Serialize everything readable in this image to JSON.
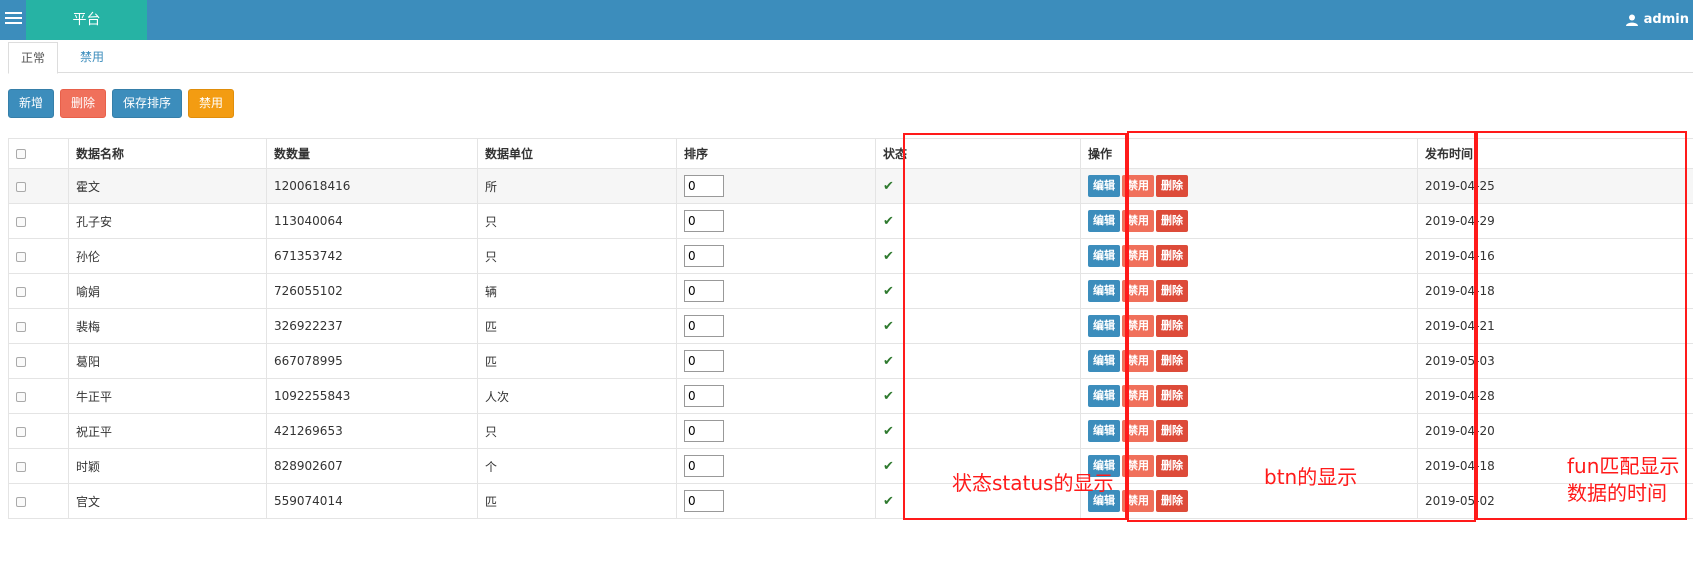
{
  "header": {
    "brand": "平台",
    "user": "admin",
    "menu_icon": "hamburger-icon",
    "user_icon": "user-icon",
    "color": "#3c8dbc",
    "brand_color": "#26b3a4"
  },
  "tabs": [
    {
      "label": "正常",
      "active": true
    },
    {
      "label": "禁用",
      "active": false
    }
  ],
  "toolbar": {
    "add": "新增",
    "delete": "删除",
    "save_sort": "保存排序",
    "disable": "禁用"
  },
  "table": {
    "columns": [
      "数据名称",
      "数数量",
      "数据单位",
      "排序",
      "状态",
      "操作",
      "发布时间"
    ],
    "action_labels": {
      "edit": "编辑",
      "disable": "禁用",
      "delete": "删除"
    },
    "status_icon": "check-icon",
    "rows": [
      {
        "name": "霍文",
        "count": "1200618416",
        "unit": "所",
        "sort": "0",
        "date": "2019-04-25"
      },
      {
        "name": "孔子安",
        "count": "113040064",
        "unit": "只",
        "sort": "0",
        "date": "2019-04-29"
      },
      {
        "name": "孙伦",
        "count": "671353742",
        "unit": "只",
        "sort": "0",
        "date": "2019-04-16"
      },
      {
        "name": "喻娟",
        "count": "726055102",
        "unit": "辆",
        "sort": "0",
        "date": "2019-04-18"
      },
      {
        "name": "裴梅",
        "count": "326922237",
        "unit": "匹",
        "sort": "0",
        "date": "2019-04-21"
      },
      {
        "name": "葛阳",
        "count": "667078995",
        "unit": "匹",
        "sort": "0",
        "date": "2019-05-03"
      },
      {
        "name": "牛正平",
        "count": "1092255843",
        "unit": "人次",
        "sort": "0",
        "date": "2019-04-28"
      },
      {
        "name": "祝正平",
        "count": "421269653",
        "unit": "只",
        "sort": "0",
        "date": "2019-04-20"
      },
      {
        "name": "时颖",
        "count": "828902607",
        "unit": "个",
        "sort": "0",
        "date": "2019-04-18"
      },
      {
        "name": "官文",
        "count": "559074014",
        "unit": "匹",
        "sort": "0",
        "date": "2019-05-02"
      }
    ]
  },
  "annotations": {
    "status": "状态status的显示",
    "btn": "btn的显示",
    "fun_line1": "fun匹配显示",
    "fun_line2": "数据的时间",
    "color": "#ff1a1a"
  }
}
